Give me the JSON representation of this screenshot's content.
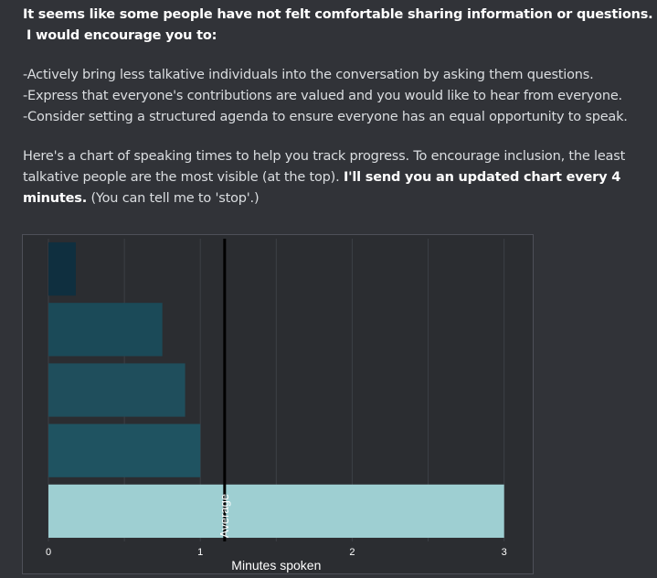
{
  "message": {
    "intro_line1": "It seems like some people have not felt comfortable sharing information or questions.",
    "intro_line2": "I would encourage you to:",
    "suggestions": [
      "-Actively bring less talkative individuals into the conversation by asking them questions.",
      "-Express that everyone's contributions are valued and you would like to hear from everyone.",
      "-Consider setting a structured agenda to ensure everyone has an equal opportunity to speak."
    ],
    "para_start": "Here's a chart of speaking times to help you track progress. To encourage inclusion, the least talkative people are the most visible (at the top). ",
    "para_bold": "I'll send you an updated chart every 4 minutes.",
    "para_end": " (You can tell me to 'stop'.)"
  },
  "chart_data": {
    "type": "bar",
    "orientation": "horizontal",
    "categories": [
      "",
      "",
      "",
      "",
      ""
    ],
    "values": [
      0.18,
      0.75,
      0.9,
      1.0,
      3.0
    ],
    "average": 1.16,
    "average_label": "Average",
    "xlabel": "Minutes spoken",
    "xticks": [
      "0",
      "1",
      "2",
      "3"
    ],
    "xlim": [
      0,
      3.02
    ],
    "grid": "vertical",
    "bar_colors": [
      "#0f2f3f",
      "#1b4a58",
      "#1f4e5c",
      "#1f5361",
      "#9ecfd2"
    ],
    "average_color": "#000000"
  }
}
